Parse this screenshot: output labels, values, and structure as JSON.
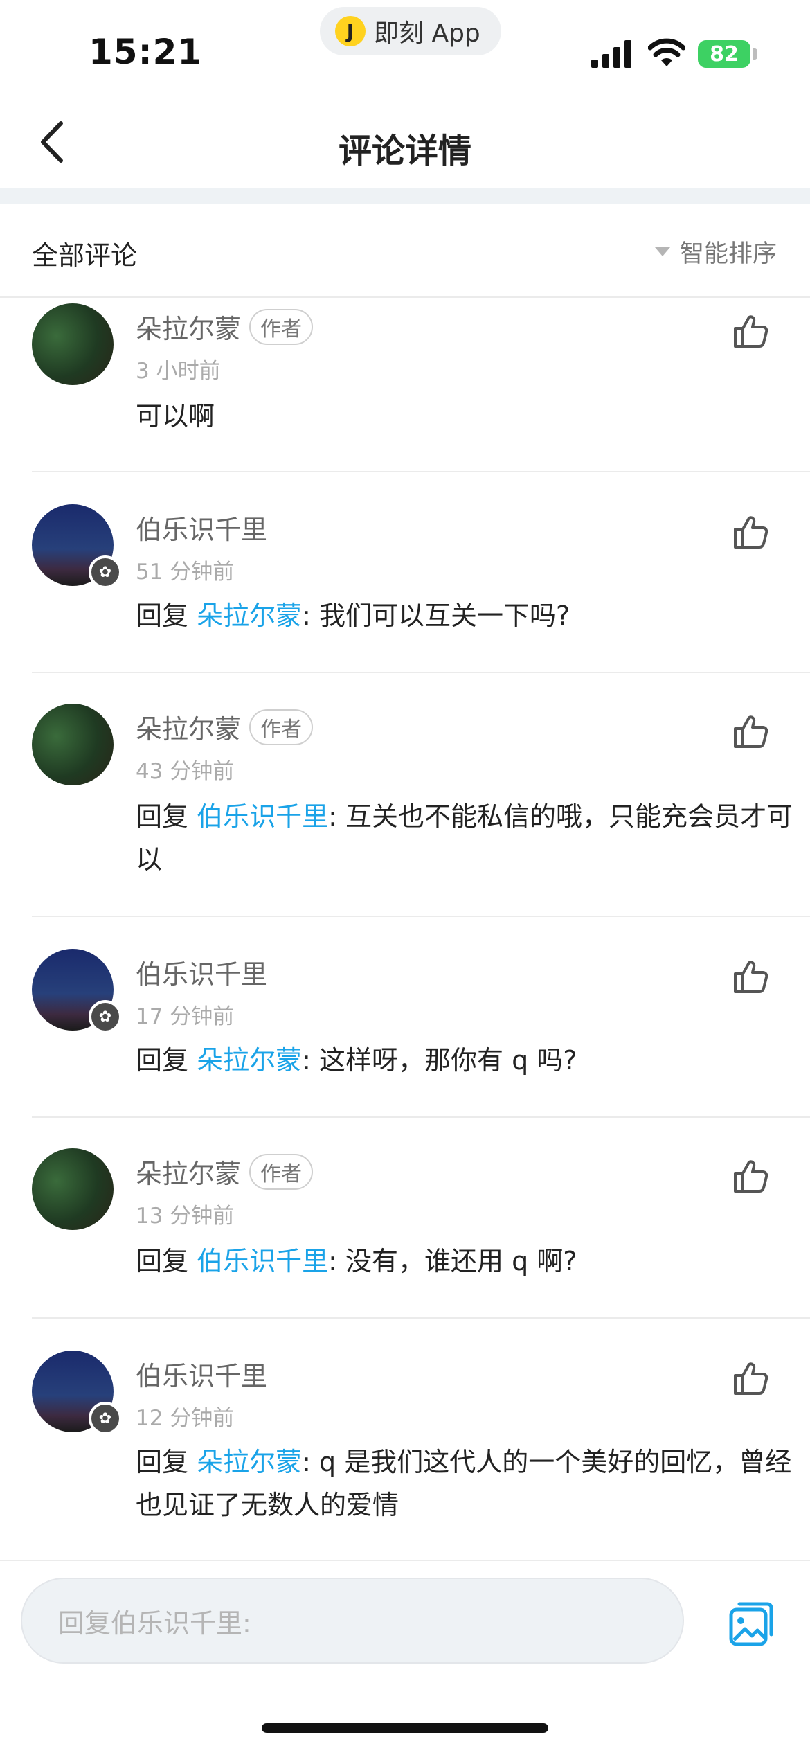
{
  "status": {
    "time": "15:21",
    "app_pill": "即刻 App",
    "battery": "82"
  },
  "nav": {
    "title": "评论详情"
  },
  "filter": {
    "title": "全部评论",
    "sort_label": "智能排序"
  },
  "comments": [
    {
      "author": "朵拉尔蒙",
      "tag": "作者",
      "time": "3 小时前",
      "reply_prefix": "",
      "mention": "",
      "text": "可以啊",
      "avatar": "a"
    },
    {
      "author": "伯乐识千里",
      "tag": "",
      "time": "51 分钟前",
      "reply_prefix": "回复 ",
      "mention": "朵拉尔蒙",
      "text": ": 我们可以互关一下吗?",
      "avatar": "b"
    },
    {
      "author": "朵拉尔蒙",
      "tag": "作者",
      "time": "43 分钟前",
      "reply_prefix": "回复 ",
      "mention": "伯乐识千里",
      "text": ": 互关也不能私信的哦，只能充会员才可以",
      "avatar": "a"
    },
    {
      "author": "伯乐识千里",
      "tag": "",
      "time": "17 分钟前",
      "reply_prefix": "回复 ",
      "mention": "朵拉尔蒙",
      "text": ": 这样呀，那你有 q 吗?",
      "avatar": "b"
    },
    {
      "author": "朵拉尔蒙",
      "tag": "作者",
      "time": "13 分钟前",
      "reply_prefix": "回复 ",
      "mention": "伯乐识千里",
      "text": ": 没有，谁还用 q 啊?",
      "avatar": "a"
    },
    {
      "author": "伯乐识千里",
      "tag": "",
      "time": "12 分钟前",
      "reply_prefix": "回复 ",
      "mention": "朵拉尔蒙",
      "text": ": q 是我们这代人的一个美好的回忆，曾经也见证了无数人的爱情",
      "avatar": "b"
    }
  ],
  "reply_bar": {
    "placeholder": "回复伯乐识千里:"
  },
  "colors": {
    "accent": "#1aa3e8",
    "battery": "#3dd163",
    "app_pill_icon": "#ffd21f"
  },
  "icons": [
    "back-chevron-icon",
    "sort-triangle-icon",
    "thumbs-up-icon",
    "image-picker-icon",
    "signal-icon",
    "wifi-icon",
    "battery-icon"
  ]
}
